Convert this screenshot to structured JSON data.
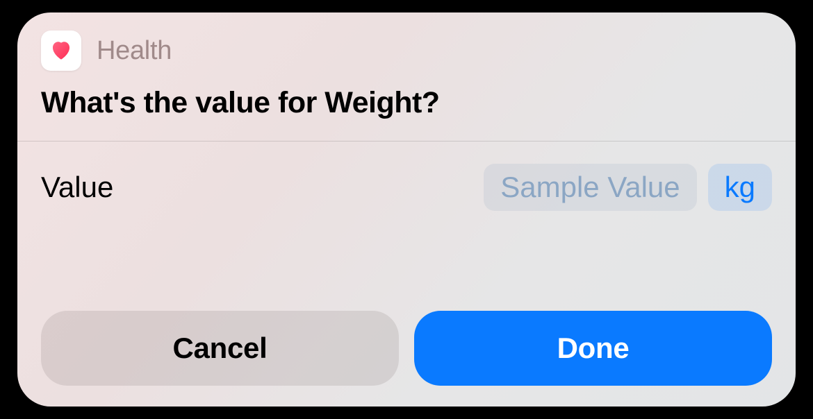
{
  "header": {
    "app_name": "Health"
  },
  "prompt": "What's the value for Weight?",
  "row": {
    "label": "Value",
    "placeholder": "Sample Value",
    "unit": "kg"
  },
  "buttons": {
    "cancel": "Cancel",
    "done": "Done"
  }
}
